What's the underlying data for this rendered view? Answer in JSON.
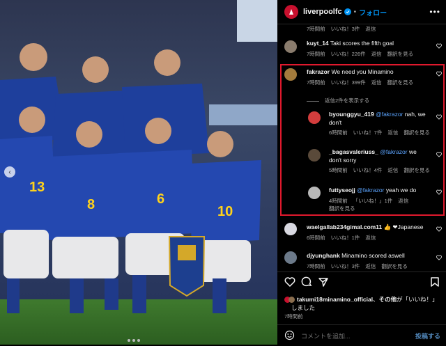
{
  "header": {
    "username": "liverpoolfc",
    "separator": "•",
    "follow_label": "フォロー",
    "more_label": "•••"
  },
  "comments": [
    {
      "id": "c0",
      "meta": [
        "7時間前",
        "いいね！3件",
        "返信"
      ],
      "partial": true
    },
    {
      "id": "c1",
      "username": "kuyt_14",
      "text": "Taki scores the fifth goal",
      "meta": [
        "7時間前",
        "いいね！226件",
        "返信",
        "翻訳を見る"
      ]
    },
    {
      "id": "c2",
      "username": "fakrazor",
      "text": "We need you Minamino",
      "meta": [
        "7時間前",
        "いいね！399件",
        "返信",
        "翻訳を見る"
      ],
      "replies_label": "返信2件を表示する"
    },
    {
      "id": "r1",
      "username": "byounggyu_419",
      "mention": "@fakrazor",
      "text": " nah, we don't",
      "meta": [
        "6時間前",
        "いいね！7件",
        "返信",
        "翻訳を見る"
      ]
    },
    {
      "id": "r2",
      "username": "_bagasvaleriuss_",
      "mention": "@fakrazor",
      "text": " we don't sorry",
      "meta": [
        "5時間前",
        "いいね！4件",
        "返信",
        "翻訳を見る"
      ]
    },
    {
      "id": "r3",
      "username": "futtyseojj",
      "mention": "@fakrazor",
      "text": " yeah we do",
      "meta": [
        "4時間前",
        "「いいね！」1件",
        "返信"
      ],
      "meta2": "翻訳を見る"
    },
    {
      "id": "c3",
      "username": "waelgallab234gimal.com11",
      "text": "👍 ❤Japanese",
      "meta": [
        "6時間前",
        "いいね！1件",
        "返信"
      ]
    },
    {
      "id": "c4",
      "username": "djyunghank",
      "text": "Minamino scored aswell",
      "meta": [
        "7時間前",
        "いいね！3件",
        "返信",
        "翻訳を見る"
      ]
    }
  ],
  "likes": {
    "text_user": "takumi18minamino_official",
    "text_mid": "、",
    "text_bold": "その他",
    "text_rest": "が「いいね！」",
    "text_line2": "しました"
  },
  "post_time": "7時間前",
  "add_comment": {
    "placeholder": "コメントを追加...",
    "post_label": "投稿する"
  },
  "colors": {
    "accent": "#0095f6",
    "highlight": "#e0192d",
    "background": "#000000"
  }
}
